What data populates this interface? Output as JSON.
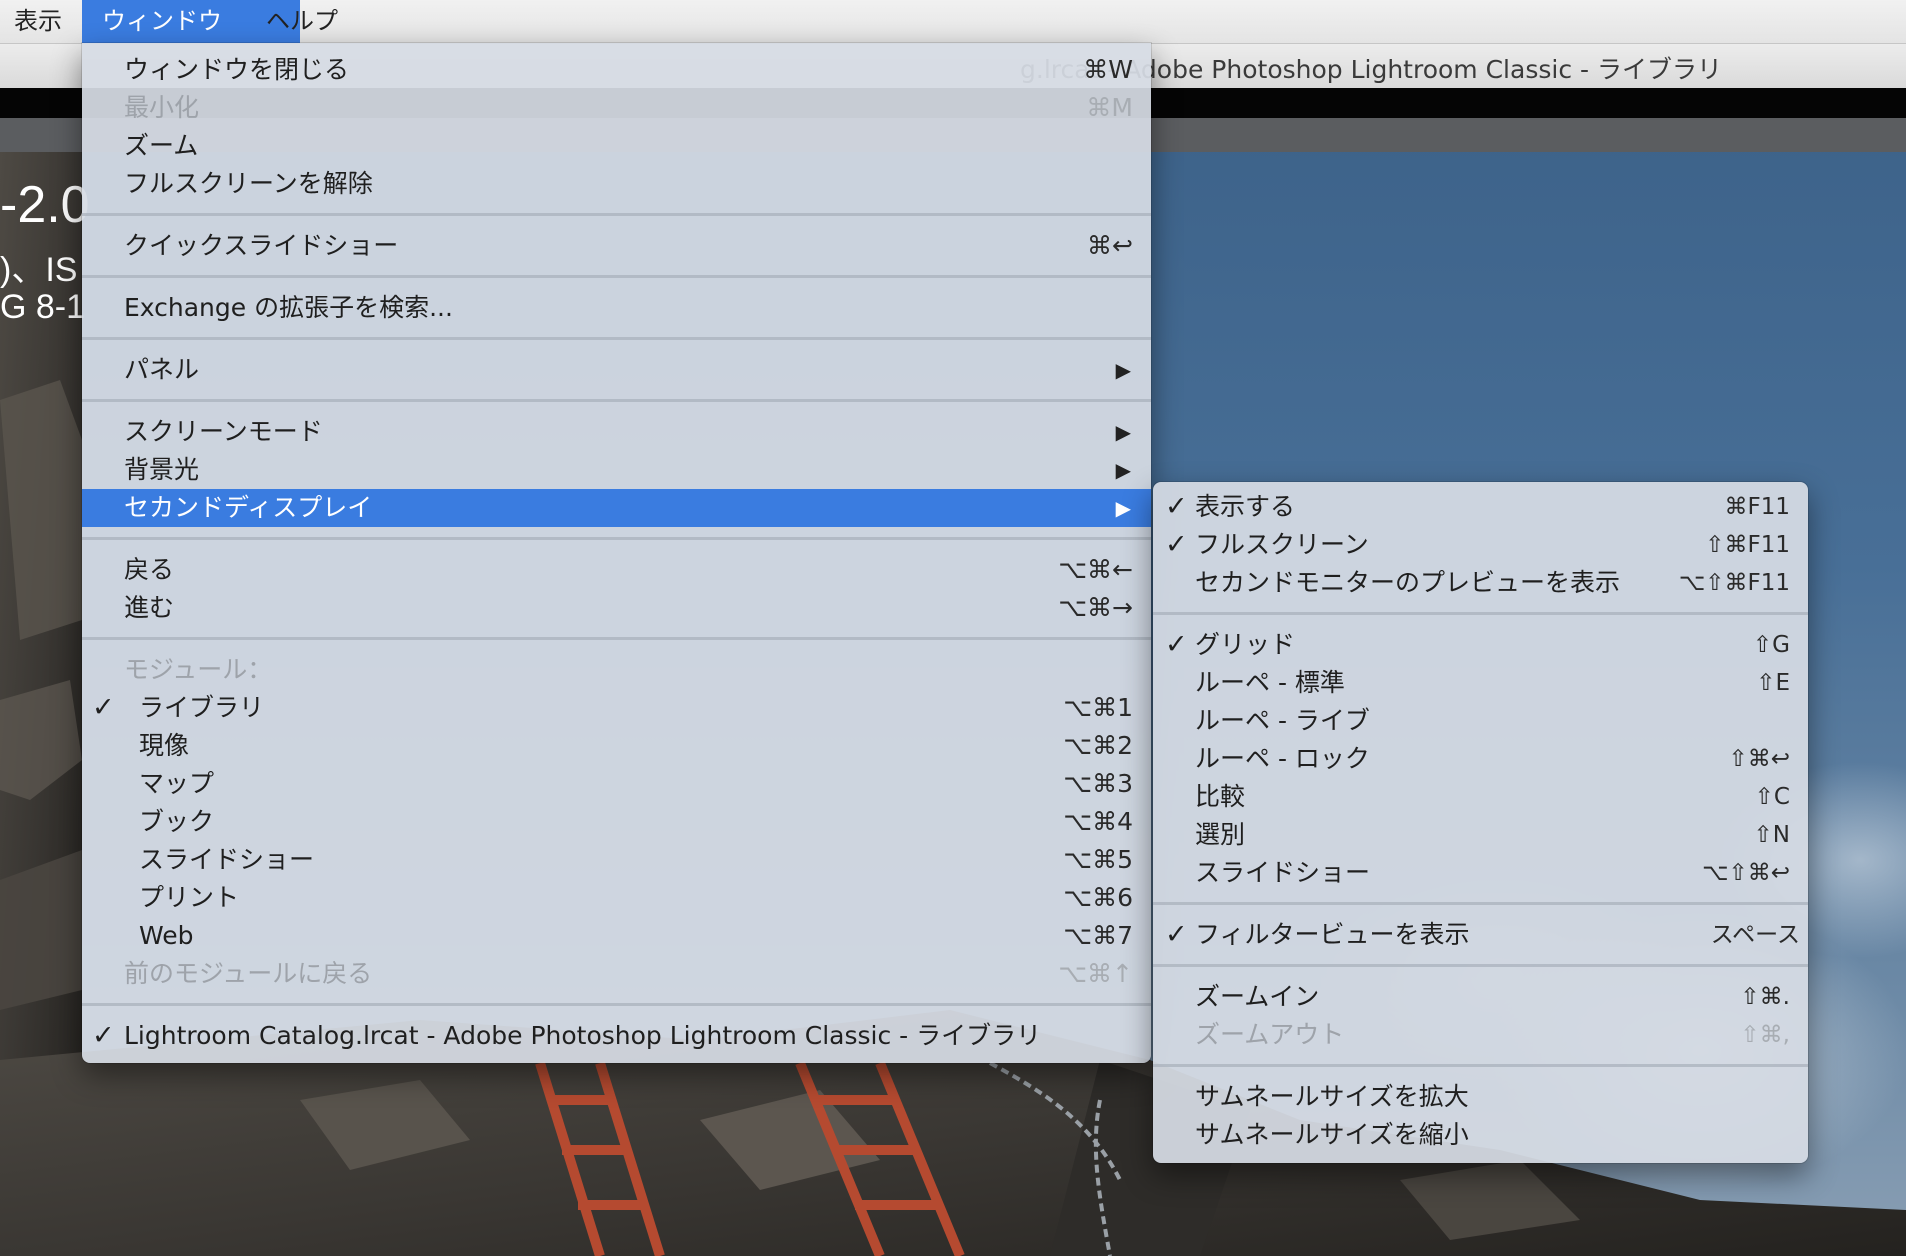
{
  "menubar": {
    "items": [
      "表示",
      "ウィンドウ",
      "ヘルプ"
    ]
  },
  "window": {
    "title_fragment": "g.lrcat - Adobe Photoshop Lightroom Classic - ライブラリ"
  },
  "overlay_info": {
    "line1": "-2.0",
    "line2": ")、IS",
    "line3": "G 8-1"
  },
  "main_menu": {
    "items": [
      {
        "label": "ウィンドウを閉じる",
        "shortcut": "⌘W"
      },
      {
        "label": "最小化",
        "shortcut": "⌘M"
      },
      {
        "label": "ズーム",
        "shortcut": ""
      },
      {
        "label": "フルスクリーンを解除",
        "shortcut": ""
      },
      {
        "label": "クイックスライドショー",
        "shortcut": "⌘↩"
      },
      {
        "label": "Exchange の拡張子を検索...",
        "shortcut": ""
      },
      {
        "label": "パネル",
        "shortcut": ""
      },
      {
        "label": "スクリーンモード",
        "shortcut": ""
      },
      {
        "label": "背景光",
        "shortcut": ""
      },
      {
        "label": "セカンドディスプレイ",
        "shortcut": ""
      },
      {
        "label": "戻る",
        "shortcut": "⌥⌘←"
      },
      {
        "label": "進む",
        "shortcut": "⌥⌘→"
      },
      {
        "label": "モジュール：",
        "shortcut": ""
      },
      {
        "label": "ライブラリ",
        "shortcut": "⌥⌘1"
      },
      {
        "label": "現像",
        "shortcut": "⌥⌘2"
      },
      {
        "label": "マップ",
        "shortcut": "⌥⌘3"
      },
      {
        "label": "ブック",
        "shortcut": "⌥⌘4"
      },
      {
        "label": "スライドショー",
        "shortcut": "⌥⌘5"
      },
      {
        "label": "プリント",
        "shortcut": "⌥⌘6"
      },
      {
        "label": "Web",
        "shortcut": "⌥⌘7"
      },
      {
        "label": "前のモジュールに戻る",
        "shortcut": "⌥⌘↑"
      },
      {
        "label": "Lightroom Catalog.lrcat - Adobe Photoshop Lightroom Classic - ライブラリ",
        "shortcut": ""
      }
    ]
  },
  "sub_menu": {
    "items": [
      {
        "label": "表示する",
        "shortcut": "⌘F11"
      },
      {
        "label": "フルスクリーン",
        "shortcut": "⇧⌘F11"
      },
      {
        "label": "セカンドモニターのプレビューを表示",
        "shortcut": "⌥⇧⌘F11"
      },
      {
        "label": "グリッド",
        "shortcut": "⇧G"
      },
      {
        "label": "ルーペ - 標準",
        "shortcut": "⇧E"
      },
      {
        "label": "ルーペ - ライブ",
        "shortcut": ""
      },
      {
        "label": "ルーペ - ロック",
        "shortcut": "⇧⌘↩"
      },
      {
        "label": "比較",
        "shortcut": "⇧C"
      },
      {
        "label": "選別",
        "shortcut": "⇧N"
      },
      {
        "label": "スライドショー",
        "shortcut": "⌥⇧⌘↩"
      },
      {
        "label": "フィルタービューを表示",
        "shortcut": "スペース"
      },
      {
        "label": "ズームイン",
        "shortcut": "⇧⌘."
      },
      {
        "label": "ズームアウト",
        "shortcut": "⇧⌘,"
      },
      {
        "label": "サムネールサイズを拡大",
        "shortcut": ""
      },
      {
        "label": "サムネールサイズを縮小",
        "shortcut": ""
      }
    ]
  },
  "glyphs": {
    "check": "✓",
    "submenu_arrow": "▶"
  },
  "colors": {
    "highlight": "#3a7ce0",
    "menu_bg": "#d6dce4",
    "disabled_text": "#9ea3aa"
  }
}
